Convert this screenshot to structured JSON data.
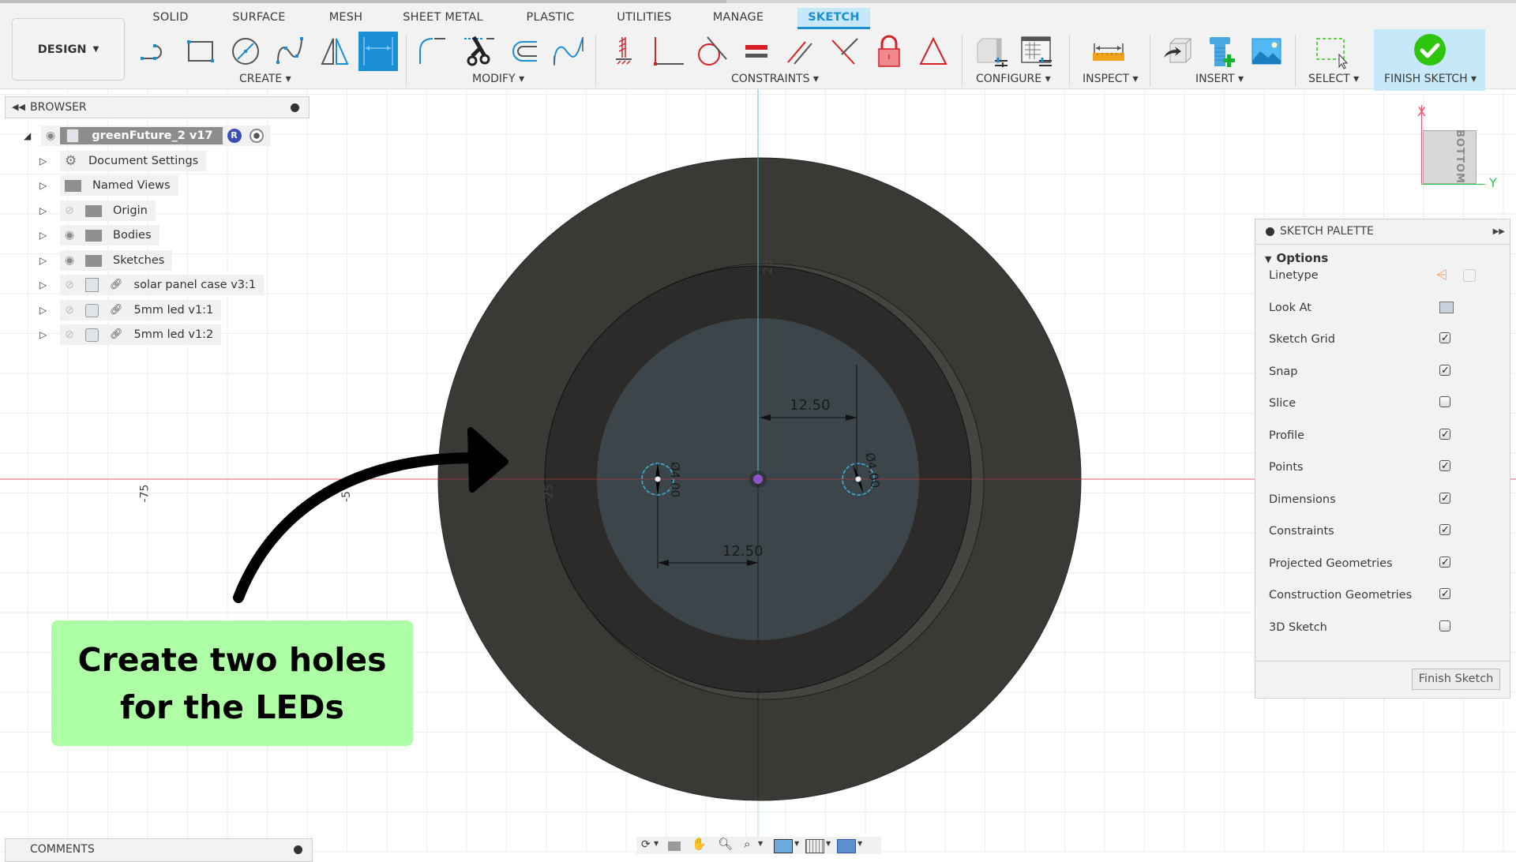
{
  "workspace": {
    "label": "DESIGN"
  },
  "tabs": [
    {
      "label": "SOLID",
      "active": false
    },
    {
      "label": "SURFACE",
      "active": false
    },
    {
      "label": "MESH",
      "active": false
    },
    {
      "label": "SHEET METAL",
      "active": false
    },
    {
      "label": "PLASTIC",
      "active": false
    },
    {
      "label": "UTILITIES",
      "active": false
    },
    {
      "label": "MANAGE",
      "active": false
    },
    {
      "label": "SKETCH",
      "active": true
    }
  ],
  "toolbar_groups": [
    {
      "label": "CREATE ▾",
      "tools": [
        "line-icon",
        "rectangle-icon",
        "circle-icon",
        "spline-icon",
        "mirror-icon",
        "sketch-dimension-icon"
      ]
    },
    {
      "label": "MODIFY ▾",
      "tools": [
        "fillet-icon",
        "trim-icon",
        "offset-icon",
        "curve-icon"
      ]
    },
    {
      "label": "CONSTRAINTS ▾",
      "tools": [
        "fix-icon",
        "coincident-icon",
        "tangent-icon",
        "equal-icon",
        "parallel-icon",
        "perpendicular-icon",
        "lock-icon",
        "triangle-icon"
      ]
    },
    {
      "label": "CONFIGURE ▾",
      "tools": [
        "change-parameters-icon",
        "configuration-table-icon"
      ]
    },
    {
      "label": "INSPECT ▾",
      "tools": [
        "measure-icon"
      ]
    },
    {
      "label": "INSERT ▾",
      "tools": [
        "insert-derive-icon",
        "insert-mcmaster-icon",
        "insert-canvas-icon"
      ]
    },
    {
      "label": "SELECT ▾",
      "tools": [
        "window-select-icon"
      ]
    },
    {
      "label": "FINISH SKETCH ▾",
      "tools": [
        "finish-sketch-check-icon"
      ]
    }
  ],
  "colors": {
    "accent": "#1a8fd6",
    "active_tab_bg": "#c7e8f8",
    "finish_green": "#2ec50e",
    "callout_bg": "#adfea5",
    "body_dark": "#3a3936",
    "sketch_face": "#3c464a",
    "x_axis": "#ff4d6a",
    "y_axis": "#27d14a"
  },
  "browser": {
    "title": "BROWSER",
    "root": {
      "label": "greenFuture_2 v17",
      "badge": "R"
    },
    "items": [
      {
        "label": "Document Settings",
        "icon": "gear-icon",
        "visible": null,
        "linked": false
      },
      {
        "label": "Named Views",
        "icon": "folder-icon",
        "visible": null,
        "linked": false
      },
      {
        "label": "Origin",
        "icon": "folder-icon",
        "visible": false,
        "linked": false
      },
      {
        "label": "Bodies",
        "icon": "folder-icon",
        "visible": true,
        "linked": false
      },
      {
        "label": "Sketches",
        "icon": "folder-icon",
        "visible": true,
        "linked": false
      },
      {
        "label": "solar panel case v3:1",
        "icon": "component-icon",
        "visible": false,
        "linked": true
      },
      {
        "label": "5mm led v1:1",
        "icon": "body-icon",
        "visible": false,
        "linked": true
      },
      {
        "label": "5mm led v1:2",
        "icon": "body-icon",
        "visible": false,
        "linked": true
      }
    ]
  },
  "viewcube": {
    "face": "BOTTOM",
    "x_label": "X",
    "y_label": "Y"
  },
  "sketch": {
    "dimensions": {
      "top_spacing": "12.50",
      "bottom_spacing": "12.50",
      "left_hole_diameter": "Ø4.00",
      "right_hole_diameter": "Ø4.00"
    },
    "axis_ticks": {
      "v_top": "25",
      "h_minus75": "-75",
      "h_minus50": "-5",
      "h_minus25": "-25"
    }
  },
  "palette": {
    "title": "SKETCH PALETTE",
    "section": "Options",
    "rows": [
      {
        "label": "Linetype",
        "type": "icons"
      },
      {
        "label": "Look At",
        "type": "icon"
      },
      {
        "label": "Sketch Grid",
        "type": "checkbox",
        "checked": true
      },
      {
        "label": "Snap",
        "type": "checkbox",
        "checked": true
      },
      {
        "label": "Slice",
        "type": "checkbox",
        "checked": false
      },
      {
        "label": "Profile",
        "type": "checkbox",
        "checked": true
      },
      {
        "label": "Points",
        "type": "checkbox",
        "checked": true
      },
      {
        "label": "Dimensions",
        "type": "checkbox",
        "checked": true
      },
      {
        "label": "Constraints",
        "type": "checkbox",
        "checked": true
      },
      {
        "label": "Projected Geometries",
        "type": "checkbox",
        "checked": true
      },
      {
        "label": "Construction Geometries",
        "type": "checkbox",
        "checked": true
      },
      {
        "label": "3D Sketch",
        "type": "checkbox",
        "checked": false
      }
    ],
    "finish_button": "Finish Sketch"
  },
  "comments": {
    "title": "COMMENTS"
  },
  "callout": {
    "line1": "Create two holes",
    "line2": "for the LEDs"
  }
}
